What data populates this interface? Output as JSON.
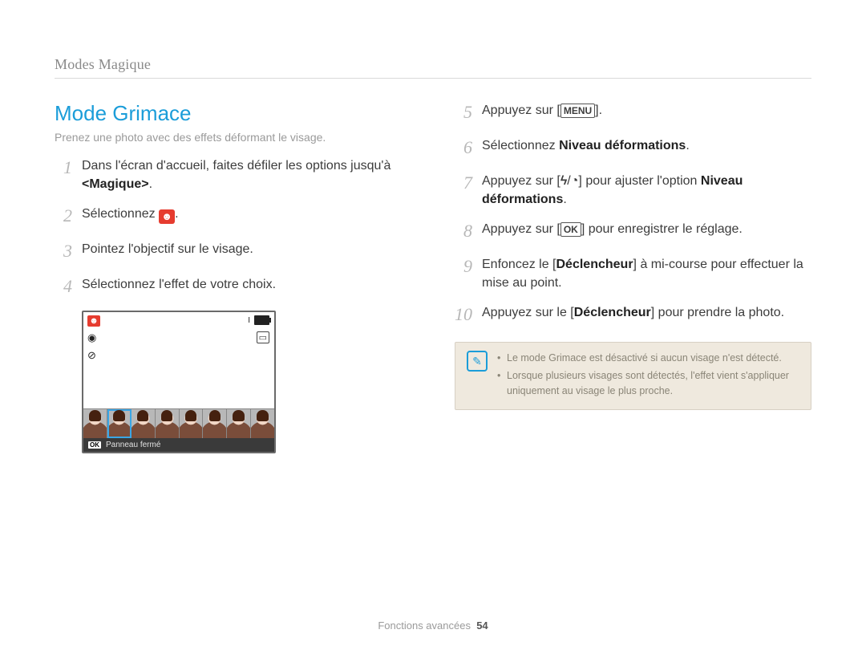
{
  "breadcrumb": "Modes Magique",
  "title": "Mode Grimace",
  "subtitle": "Prenez une photo avec des effets déformant le visage.",
  "left_steps": [
    {
      "num": "1",
      "text_before": "Dans l'écran d'accueil, faites défiler les options jusqu'à ",
      "bold": "<Magique>",
      "text_after": "."
    },
    {
      "num": "2",
      "text_before": "Sélectionnez ",
      "icon": "grimace",
      "text_after": "."
    },
    {
      "num": "3",
      "text_before": "Pointez l'objectif sur le visage.",
      "text_after": ""
    },
    {
      "num": "4",
      "text_before": "Sélectionnez l'effet de votre choix.",
      "text_after": ""
    }
  ],
  "right_steps": [
    {
      "num": "5",
      "parts": [
        {
          "t": "Appuyez sur ["
        },
        {
          "icon": "MENU"
        },
        {
          "t": "]."
        }
      ]
    },
    {
      "num": "6",
      "parts": [
        {
          "t": "Sélectionnez "
        },
        {
          "b": "Niveau déformations"
        },
        {
          "t": "."
        }
      ]
    },
    {
      "num": "7",
      "parts": [
        {
          "t": "Appuyez sur ["
        },
        {
          "icon": "flash"
        },
        {
          "t": "/"
        },
        {
          "icon": "timer"
        },
        {
          "t": "] pour ajuster l'option "
        },
        {
          "b": "Niveau déformations"
        },
        {
          "t": "."
        }
      ]
    },
    {
      "num": "8",
      "parts": [
        {
          "t": "Appuyez sur ["
        },
        {
          "icon": "OK"
        },
        {
          "t": "] pour enregistrer le réglage."
        }
      ]
    },
    {
      "num": "9",
      "parts": [
        {
          "t": "Enfoncez le ["
        },
        {
          "b": "Déclencheur"
        },
        {
          "t": "] à mi-course pour effectuer la mise au point."
        }
      ]
    },
    {
      "num": "10",
      "parts": [
        {
          "t": "Appuyez sur le ["
        },
        {
          "b": "Déclencheur"
        },
        {
          "t": "] pour prendre la photo."
        }
      ]
    }
  ],
  "preview": {
    "ok_label": "OK",
    "footer_text": "Panneau fermé",
    "thumbs": 8,
    "selected_index": 1
  },
  "notes": [
    "Le mode Grimace est désactivé si aucun visage n'est détecté.",
    "Lorsque plusieurs visages sont détectés, l'effet vient s'appliquer uniquement au visage le plus proche."
  ],
  "footer": {
    "label": "Fonctions avancées",
    "page": "54"
  },
  "icons": {
    "MENU": "MENU",
    "OK": "OK",
    "flash": "ϟ",
    "timer": "◔"
  }
}
